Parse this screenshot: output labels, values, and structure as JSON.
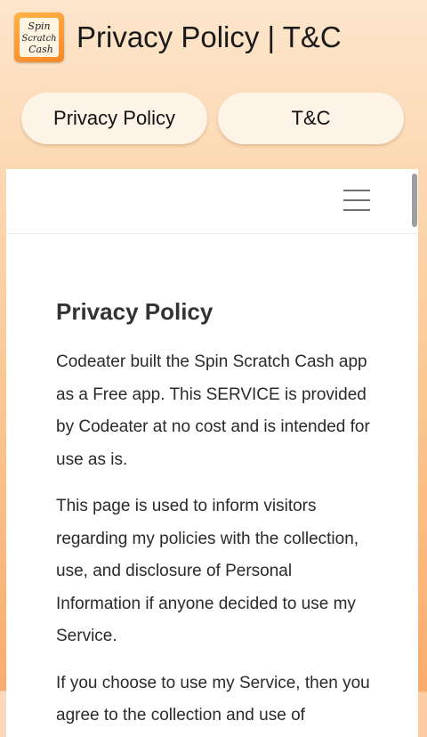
{
  "header": {
    "logo_text": [
      "Spin",
      "Scratch",
      "Cash"
    ],
    "title": "Privacy Policy | T&C"
  },
  "tabs": [
    {
      "label": "Privacy Policy"
    },
    {
      "label": "T&C"
    }
  ],
  "document": {
    "heading": "Privacy Policy",
    "paragraphs": [
      "Codeater built the Spin Scratch Cash app as a Free app. This SERVICE is provided by Codeater at no cost and is intended for use as is.",
      "This page is used to inform visitors regarding my policies with the collection, use, and disclosure of Personal Information if anyone decided to use my Service.",
      "If you choose to use my Service, then you agree to the collection and use of"
    ]
  },
  "icons": {
    "menu": "hamburger-menu-icon",
    "logo": "app-logo"
  }
}
